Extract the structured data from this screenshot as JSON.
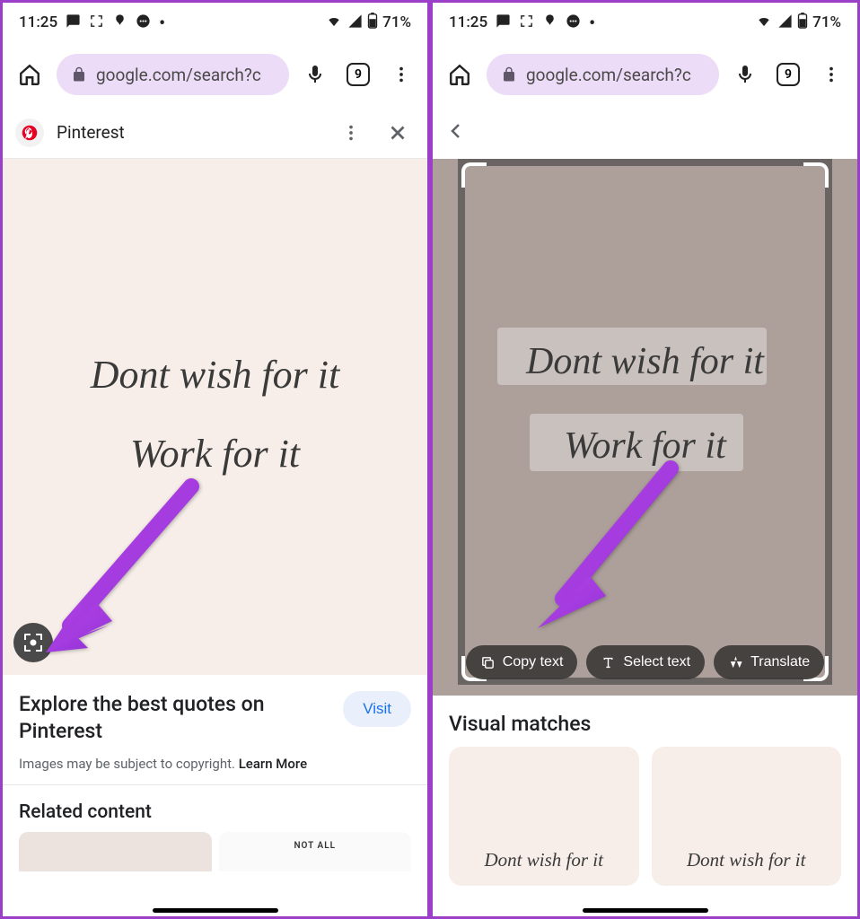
{
  "status": {
    "time": "11:25",
    "battery": "71%"
  },
  "chrome": {
    "url": "google.com/search?c",
    "tab_count": "9"
  },
  "left": {
    "source_name": "Pinterest",
    "quote_line1": "Dont wish for it",
    "quote_line2": "Work for it",
    "info_title": "Explore the best quotes on Pinterest",
    "visit_label": "Visit",
    "copyright_prefix": "Images may be subject to copyright. ",
    "copyright_link": "Learn More",
    "related_title": "Related content",
    "related_card2_text": "NOT ALL"
  },
  "right": {
    "quote_line1": "Dont wish for it",
    "quote_line2": "Work for it",
    "actions": {
      "copy": "Copy text",
      "select": "Select text",
      "translate": "Translate"
    },
    "visual_title": "Visual matches",
    "match_text": "Dont wish for it"
  }
}
